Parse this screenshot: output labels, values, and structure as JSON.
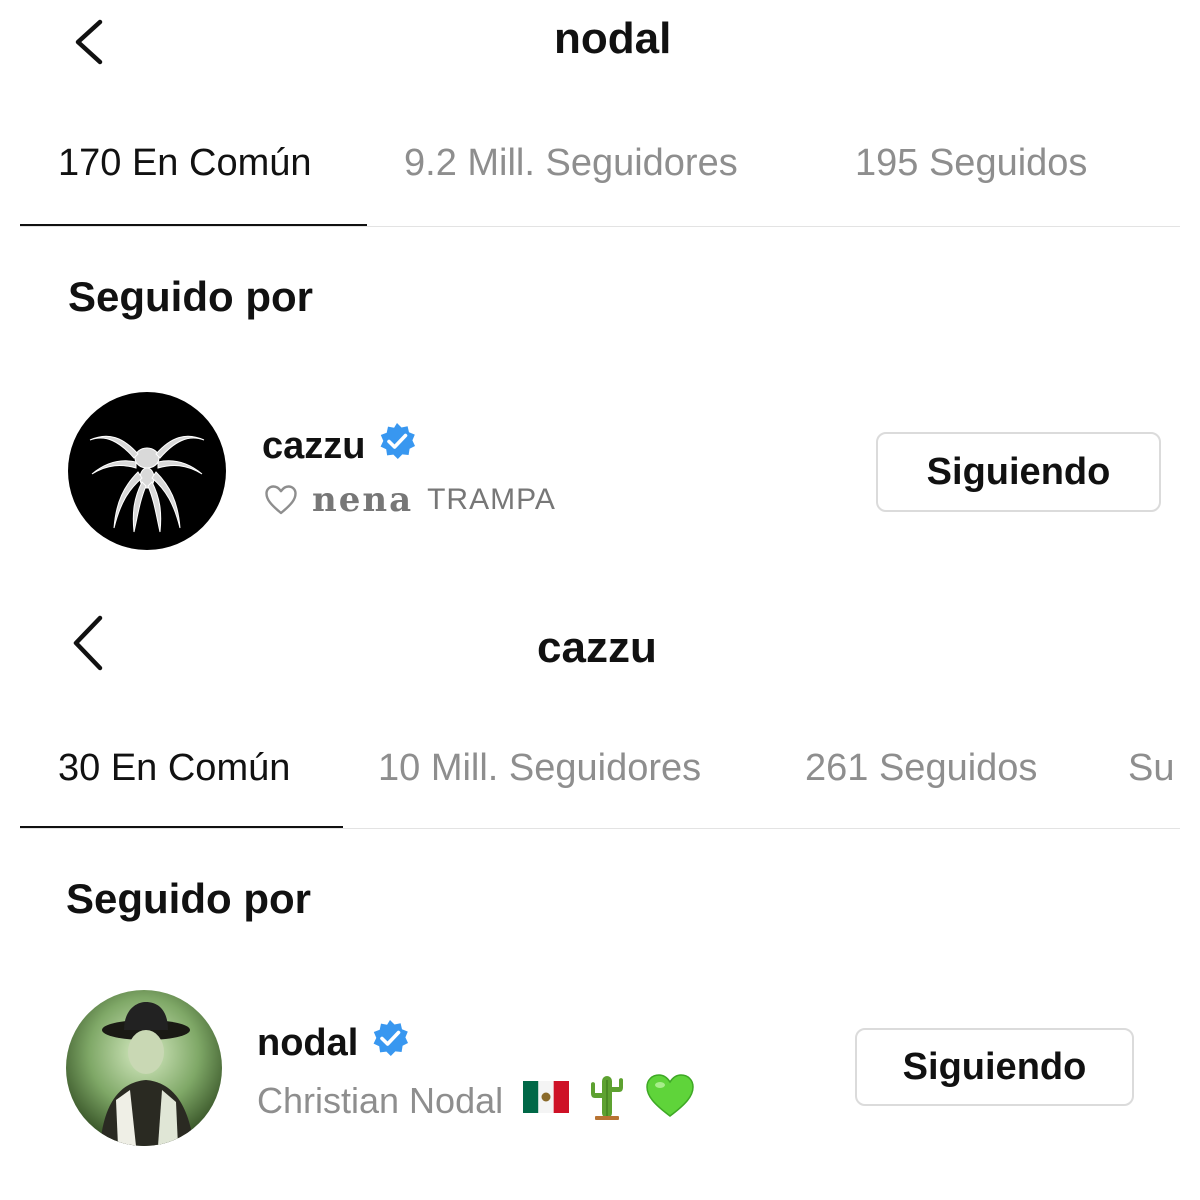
{
  "panels": [
    {
      "header_title": "nodal",
      "tabs": [
        "170 En Común",
        "9.2 Mill. Seguidores",
        "195 Seguidos"
      ],
      "section_title": "Seguido por",
      "follower": {
        "username": "cazzu",
        "bio_part1": "nena",
        "bio_part2": "TRAMPA",
        "button_label": "Siguiendo"
      }
    },
    {
      "header_title": "cazzu",
      "tabs": [
        "30 En Común",
        "10 Mill. Seguidores",
        "261 Seguidos",
        "Su"
      ],
      "section_title": "Seguido por",
      "follower": {
        "username": "nodal",
        "full_name": "Christian Nodal",
        "button_label": "Siguiendo"
      }
    }
  ],
  "icons": {
    "back": "chevron-left-icon",
    "verified": "verified-badge-icon",
    "heart": "heart-outline-icon",
    "flag": "mexico-flag-icon",
    "cactus": "cactus-icon",
    "green_heart": "green-heart-icon"
  },
  "colors": {
    "verified_blue": "#3897f0",
    "inactive_tab": "#8e8e8e",
    "active_tab": "#111111",
    "button_border": "#dbdbdb"
  }
}
